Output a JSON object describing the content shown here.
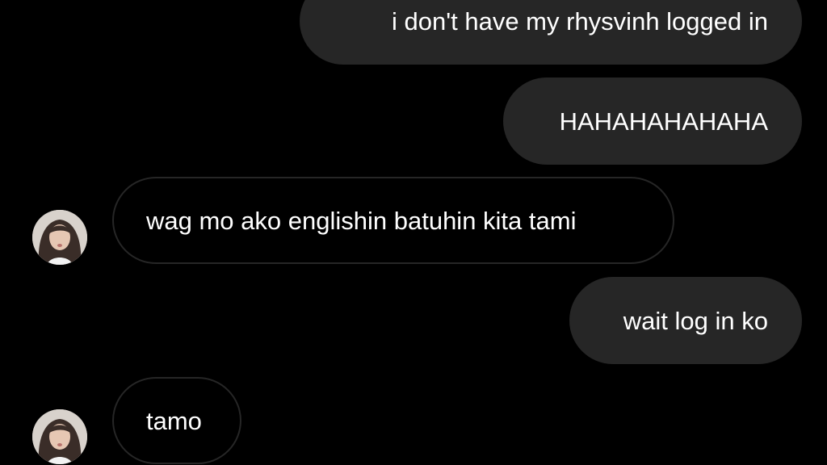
{
  "messages": [
    {
      "direction": "sent",
      "text": "i don't have my rhysvinh logged in"
    },
    {
      "direction": "sent",
      "text": "HAHAHAHAHAHA"
    },
    {
      "direction": "received",
      "text": "wag mo ako englishin batuhin kita tami"
    },
    {
      "direction": "sent",
      "text": "wait log in ko"
    },
    {
      "direction": "received",
      "text": "tamo"
    }
  ],
  "colors": {
    "background": "#000000",
    "sent_bubble": "#262626",
    "received_bubble_border": "#262626",
    "text": "#ffffff"
  }
}
